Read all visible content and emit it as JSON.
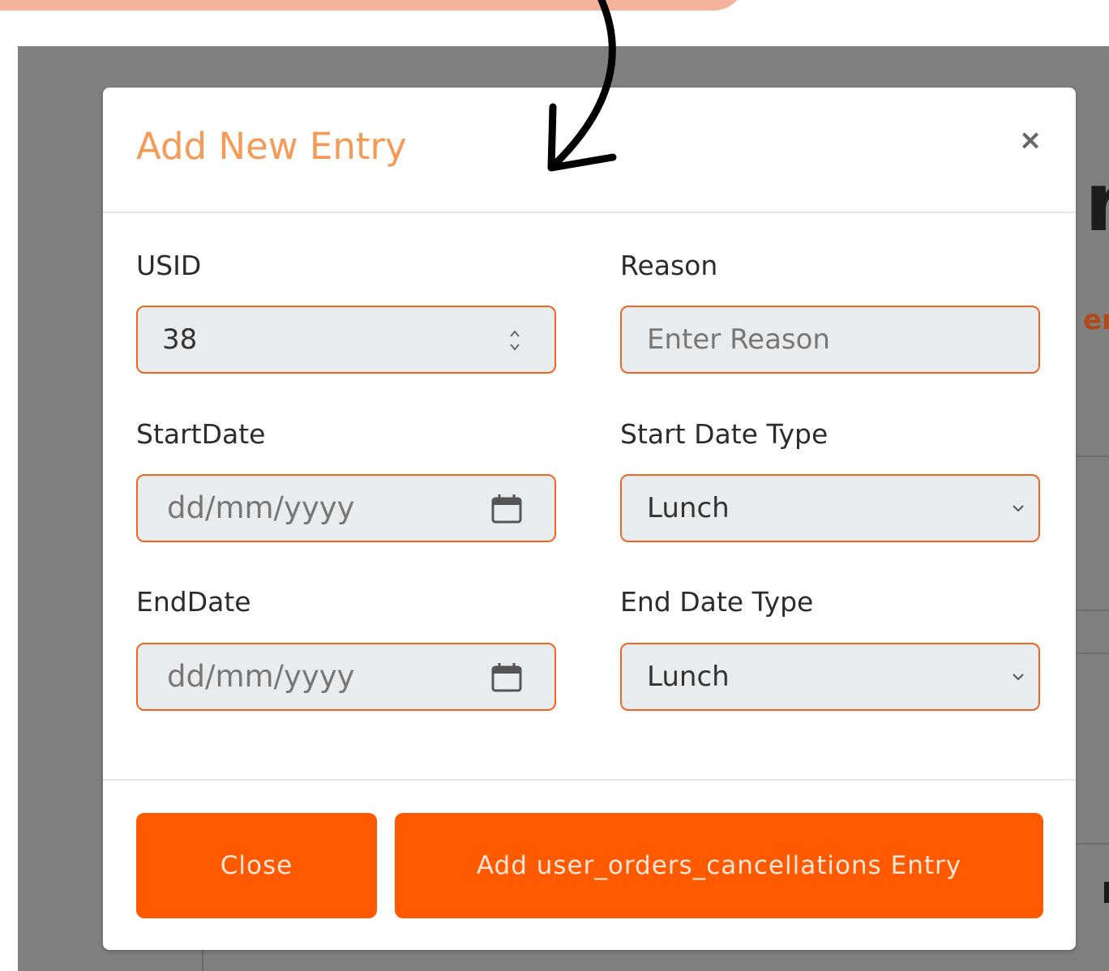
{
  "modal": {
    "title": "Add New Entry",
    "close_symbol": "×"
  },
  "fields": {
    "usid": {
      "label": "USID",
      "value": "38"
    },
    "reason": {
      "label": "Reason",
      "placeholder": "Enter Reason"
    },
    "start_date": {
      "label": "StartDate",
      "placeholder": "dd/mm/yyyy"
    },
    "start_date_type": {
      "label": "Start Date Type",
      "selected": "Lunch"
    },
    "end_date": {
      "label": "EndDate",
      "placeholder": "dd/mm/yyyy"
    },
    "end_date_type": {
      "label": "End Date Type",
      "selected": "Lunch"
    }
  },
  "footer": {
    "close_label": "Close",
    "add_label": "Add user_orders_cancellations Entry"
  },
  "background": {
    "heading_fragment": "r",
    "link_fragment": "en"
  },
  "colors": {
    "accent": "#ff5a00",
    "field_border": "#f26522",
    "title": "#f59a57",
    "backdrop": "#808080",
    "callout": "#f6b39b"
  },
  "icons": {
    "number_spinner": "spinner-icon",
    "date_picker": "calendar-icon",
    "select": "chevron-down-icon",
    "close": "close-icon",
    "annotation": "hand-drawn-arrow-icon"
  }
}
